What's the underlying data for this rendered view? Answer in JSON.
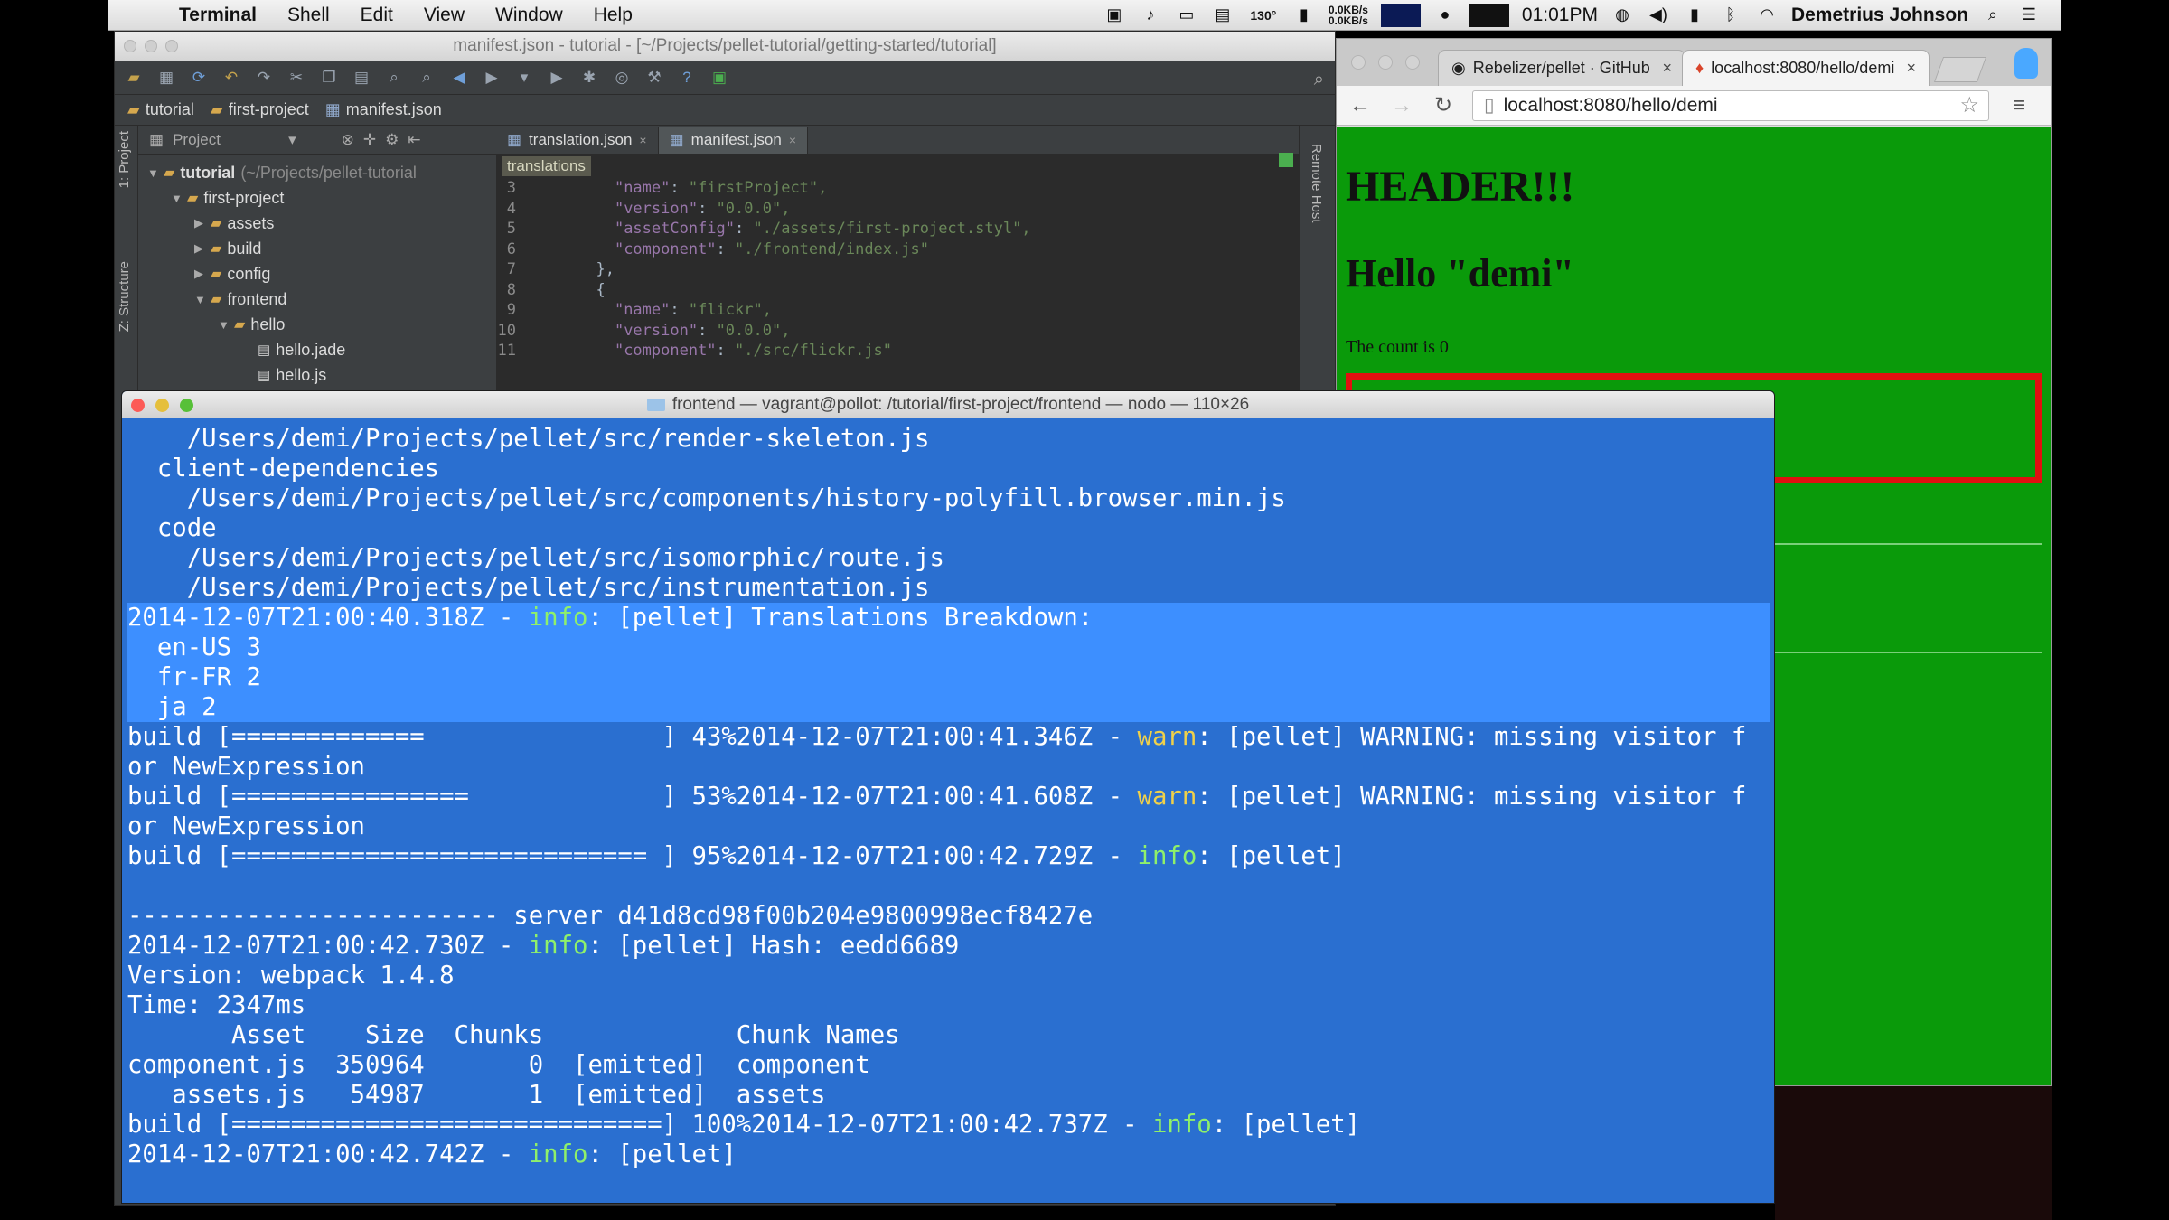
{
  "menubar": {
    "app": "Terminal",
    "menus": [
      "Shell",
      "Edit",
      "View",
      "Window",
      "Help"
    ],
    "temperature": "130°",
    "net_up": "0.0KB/s",
    "net_down": "0.0KB/s",
    "clock": "01:01PM",
    "user": "Demetrius Johnson"
  },
  "ide": {
    "title": "manifest.json - tutorial - [~/Projects/pellet-tutorial/getting-started/tutorial]",
    "breadcrumbs": [
      "tutorial",
      "first-project",
      "manifest.json"
    ],
    "project_label": "Project",
    "side_labels": [
      "1: Project",
      "Z: Structure"
    ],
    "remote_host": "Remote Host",
    "tree": [
      {
        "depth": 0,
        "open": true,
        "type": "folder",
        "name": "tutorial",
        "hint": "(~/Projects/pellet-tutorial"
      },
      {
        "depth": 1,
        "open": true,
        "type": "folder",
        "name": "first-project",
        "hint": ""
      },
      {
        "depth": 2,
        "open": false,
        "type": "folder",
        "name": "assets",
        "hint": ""
      },
      {
        "depth": 2,
        "open": false,
        "type": "folder",
        "name": "build",
        "hint": ""
      },
      {
        "depth": 2,
        "open": false,
        "type": "folder",
        "name": "config",
        "hint": ""
      },
      {
        "depth": 2,
        "open": true,
        "type": "folder",
        "name": "frontend",
        "hint": ""
      },
      {
        "depth": 3,
        "open": true,
        "type": "folder",
        "name": "hello",
        "hint": ""
      },
      {
        "depth": 4,
        "open": false,
        "type": "file",
        "name": "hello.jade",
        "hint": ""
      },
      {
        "depth": 4,
        "open": false,
        "type": "file",
        "name": "hello.js",
        "hint": ""
      }
    ],
    "tabs": [
      {
        "label": "translation.json",
        "active": false
      },
      {
        "label": "manifest.json",
        "active": true
      }
    ],
    "crumb": "translations",
    "code": [
      {
        "n": "3",
        "indent": "    ",
        "key": "\"name\"",
        "val": "\"firstProject\","
      },
      {
        "n": "4",
        "indent": "    ",
        "key": "\"version\"",
        "val": "\"0.0.0\","
      },
      {
        "n": "5",
        "indent": "    ",
        "key": "\"assetConfig\"",
        "val": "\"./assets/first-project.styl\","
      },
      {
        "n": "6",
        "indent": "    ",
        "key": "\"component\"",
        "val": "\"./frontend/index.js\""
      },
      {
        "n": "7",
        "indent": "  ",
        "key": "},",
        "val": ""
      },
      {
        "n": "8",
        "indent": "  ",
        "key": "{",
        "val": ""
      },
      {
        "n": "9",
        "indent": "    ",
        "key": "\"name\"",
        "val": "\"flickr\","
      },
      {
        "n": "10",
        "indent": "    ",
        "key": "\"version\"",
        "val": "\"0.0.0\","
      },
      {
        "n": "11",
        "indent": "    ",
        "key": "\"component\"",
        "val": "\"./src/flickr.js\""
      }
    ]
  },
  "browser": {
    "tabs": [
      {
        "label": "Rebelizer/pellet · GitHub",
        "active": false,
        "icon": "github-icon"
      },
      {
        "label": "localhost:8080/hello/demi",
        "active": true,
        "icon": "flame-icon"
      }
    ],
    "url": "localhost:8080/hello/demi",
    "page": {
      "header": "HEADER!!!",
      "hello": "Hello \"demi\"",
      "count": "The count is 0"
    }
  },
  "terminal": {
    "title": "frontend — vagrant@pollot: /tutorial/first-project/frontend — nodo — 110×26",
    "lines": [
      {
        "sel": false,
        "parts": [
          {
            "t": "    /Users/demi/Projects/pellet/src/render-skeleton.js",
            "c": ""
          }
        ]
      },
      {
        "sel": false,
        "parts": [
          {
            "t": "  client-dependencies",
            "c": ""
          }
        ]
      },
      {
        "sel": false,
        "parts": [
          {
            "t": "    /Users/demi/Projects/pellet/src/components/history-polyfill.browser.min.js",
            "c": ""
          }
        ]
      },
      {
        "sel": false,
        "parts": [
          {
            "t": "  code",
            "c": ""
          }
        ]
      },
      {
        "sel": false,
        "parts": [
          {
            "t": "    /Users/demi/Projects/pellet/src/isomorphic/route.js",
            "c": ""
          }
        ]
      },
      {
        "sel": false,
        "parts": [
          {
            "t": "    /Users/demi/Projects/pellet/src/instrumentation.js",
            "c": ""
          }
        ]
      },
      {
        "sel": true,
        "parts": [
          {
            "t": "2014-12-07T21:00:40.318Z - ",
            "c": ""
          },
          {
            "t": "info",
            "c": "info"
          },
          {
            "t": ": [pellet] Translations Breakdown:",
            "c": ""
          }
        ]
      },
      {
        "sel": true,
        "parts": [
          {
            "t": "  en-US 3",
            "c": ""
          }
        ]
      },
      {
        "sel": true,
        "parts": [
          {
            "t": "  fr-FR 2",
            "c": ""
          }
        ]
      },
      {
        "sel": true,
        "parts": [
          {
            "t": "  ja 2",
            "c": ""
          }
        ]
      },
      {
        "sel": false,
        "parts": [
          {
            "t": "build [=============                ] 43%2014-12-07T21:00:41.346Z - ",
            "c": ""
          },
          {
            "t": "warn",
            "c": "warn"
          },
          {
            "t": ": [pellet] WARNING: missing visitor f",
            "c": ""
          }
        ]
      },
      {
        "sel": false,
        "parts": [
          {
            "t": "or NewExpression",
            "c": ""
          }
        ]
      },
      {
        "sel": false,
        "parts": [
          {
            "t": "build [================             ] 53%2014-12-07T21:00:41.608Z - ",
            "c": ""
          },
          {
            "t": "warn",
            "c": "warn"
          },
          {
            "t": ": [pellet] WARNING: missing visitor f",
            "c": ""
          }
        ]
      },
      {
        "sel": false,
        "parts": [
          {
            "t": "or NewExpression",
            "c": ""
          }
        ]
      },
      {
        "sel": false,
        "parts": [
          {
            "t": "build [============================ ] 95%2014-12-07T21:00:42.729Z - ",
            "c": ""
          },
          {
            "t": "info",
            "c": "info"
          },
          {
            "t": ": [pellet]",
            "c": ""
          }
        ]
      },
      {
        "sel": false,
        "parts": [
          {
            "t": "",
            "c": ""
          }
        ]
      },
      {
        "sel": false,
        "parts": [
          {
            "t": "------------------------- server d41d8cd98f00b204e9800998ecf8427e",
            "c": ""
          }
        ]
      },
      {
        "sel": false,
        "parts": [
          {
            "t": "2014-12-07T21:00:42.730Z - ",
            "c": ""
          },
          {
            "t": "info",
            "c": "info"
          },
          {
            "t": ": [pellet] Hash: eedd6689",
            "c": ""
          }
        ]
      },
      {
        "sel": false,
        "parts": [
          {
            "t": "Version: webpack 1.4.8",
            "c": ""
          }
        ]
      },
      {
        "sel": false,
        "parts": [
          {
            "t": "Time: 2347ms",
            "c": ""
          }
        ]
      },
      {
        "sel": false,
        "parts": [
          {
            "t": "       Asset    Size  Chunks             Chunk Names",
            "c": ""
          }
        ]
      },
      {
        "sel": false,
        "parts": [
          {
            "t": "component.js  350964       0  [emitted]  component",
            "c": ""
          }
        ]
      },
      {
        "sel": false,
        "parts": [
          {
            "t": "   assets.js   54987       1  [emitted]  assets",
            "c": ""
          }
        ]
      },
      {
        "sel": false,
        "parts": [
          {
            "t": "build [=============================] 100%2014-12-07T21:00:42.737Z - ",
            "c": ""
          },
          {
            "t": "info",
            "c": "info"
          },
          {
            "t": ": [pellet]",
            "c": ""
          }
        ]
      },
      {
        "sel": false,
        "parts": [
          {
            "t": "2014-12-07T21:00:42.742Z - ",
            "c": ""
          },
          {
            "t": "info",
            "c": "info"
          },
          {
            "t": ": [pellet]",
            "c": ""
          }
        ]
      }
    ]
  },
  "colors": {
    "terminal_bg": "#2a6fd0",
    "terminal_selection": "#3d8fff",
    "info": "#8ff06a",
    "warn": "#f0d14a",
    "page_bg": "#0a9a0a",
    "red_box": "#e01010"
  }
}
